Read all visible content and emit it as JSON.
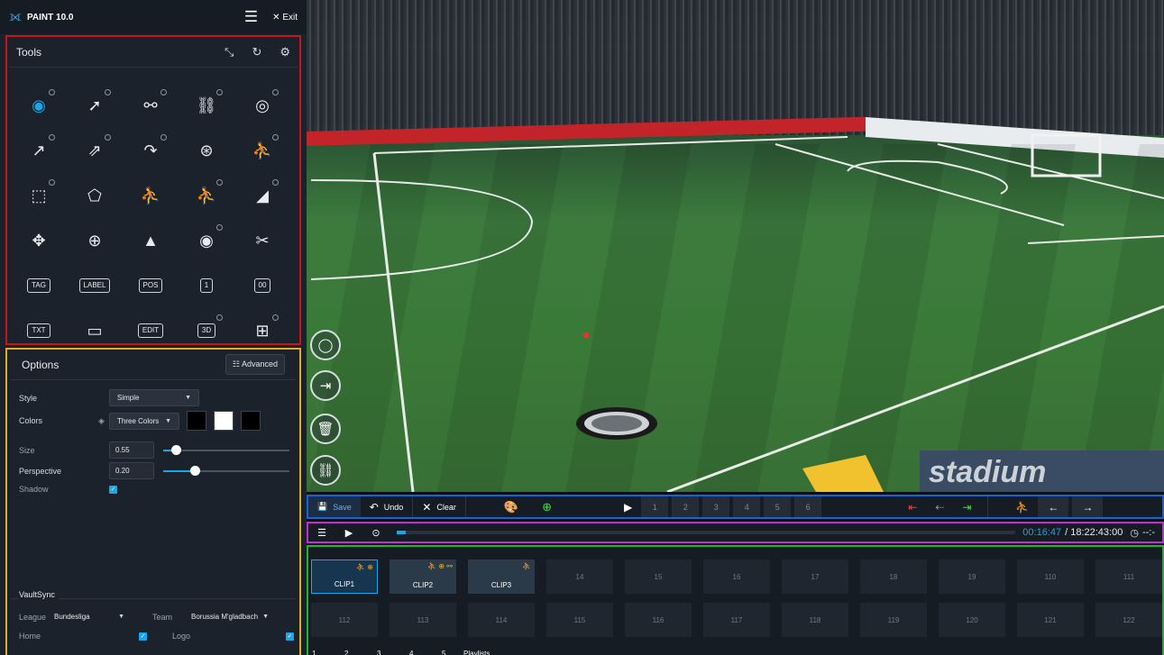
{
  "app": {
    "title": "PAINT 10.0",
    "exit_label": "Exit"
  },
  "tools": {
    "title": "Tools"
  },
  "options": {
    "title": "Options",
    "advanced_label": "Advanced",
    "style": {
      "label": "Style",
      "value": "Simple"
    },
    "colors": {
      "label": "Colors",
      "value": "Three Colors",
      "swatches": [
        "#000000",
        "#ffffff",
        "#000000"
      ]
    },
    "size": {
      "label": "Size",
      "value": "0.55",
      "level": 0.1
    },
    "perspective": {
      "label": "Perspective",
      "value": "0.20",
      "level": 0.25
    },
    "shadow": {
      "label": "Shadow",
      "checked": true
    }
  },
  "vault": {
    "title": "VaultSync",
    "league_label": "League",
    "league_value": "Bundesliga",
    "team_label": "Team",
    "team_value": "Borussia M'gladbach",
    "home_label": "Home",
    "logo_label": "Logo"
  },
  "controls": {
    "save_label": "Save",
    "undo_label": "Undo",
    "clear_label": "Clear",
    "cams": [
      "1",
      "2",
      "3",
      "4",
      "5",
      "6"
    ]
  },
  "timeline": {
    "current": "00:16:47",
    "total": "/ 18:22:43:00",
    "extra": "--:-",
    "progress": 0.015
  },
  "clips": {
    "row1": [
      "CLIP1",
      "CLIP2",
      "CLIP3",
      "14",
      "15",
      "16",
      "17",
      "18",
      "19",
      "110",
      "111"
    ],
    "row2": [
      "112",
      "113",
      "114",
      "115",
      "116",
      "117",
      "118",
      "119",
      "120",
      "121",
      "122"
    ],
    "pages": [
      "1",
      "2",
      "3",
      "4",
      "5"
    ],
    "playlists_label": "Playlists"
  },
  "video": {
    "board_text": "stadium"
  },
  "accent": "#1aa6e8"
}
